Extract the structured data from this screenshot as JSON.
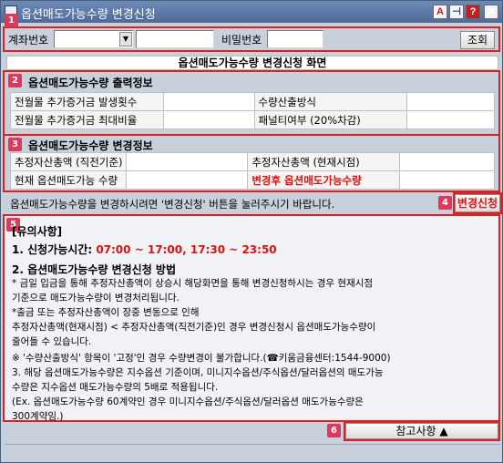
{
  "window": {
    "title": "옵션매도가능수량 변경신청"
  },
  "titlebar_buttons": [
    {
      "name": "font-a-icon",
      "label": "A"
    },
    {
      "name": "pin-icon",
      "label": "⊣"
    },
    {
      "name": "help-icon",
      "label": "?"
    },
    {
      "name": "close-icon",
      "label": "✕"
    }
  ],
  "badges": [
    "1",
    "2",
    "3",
    "4",
    "5",
    "6"
  ],
  "query": {
    "account_label": "계좌번호",
    "account_value": "",
    "account_name_value": "",
    "password_label": "비밀번호",
    "password_value": "",
    "search_button": "조회"
  },
  "screen_header": "옵션매도가능수량 변경신청 화면",
  "output_info": {
    "title": "옵션매도가능수량 출력정보",
    "rows": [
      {
        "label1": "전월물 추가증거금 발생횟수",
        "value1": "",
        "label2": "수량산출방식",
        "value2": ""
      },
      {
        "label1": "전월물 추가증거금 최대비율",
        "value1": "",
        "label2": "패널티여부 (20%차감)",
        "value2": ""
      }
    ]
  },
  "change_info": {
    "title": "옵션매도가능수량 변경정보",
    "rows": [
      {
        "label1": "추정자산총액 (직전기준)",
        "value1": "",
        "label2": "추정자산총액 (현재시점)",
        "value2": ""
      },
      {
        "label1": "현재 옵션매도가능 수량",
        "value1": "",
        "label2": "변경후 옵션매도가능수량",
        "value2": ""
      }
    ]
  },
  "instruction": "옵션매도가능수량을 변경하시려면 '변경신청' 버튼을 눌러주시기 바랍니다.",
  "change_button": "변경신청",
  "notice": {
    "title": "[유의사항]",
    "item1_prefix": "1. 신청가능시간: ",
    "item1_time": "07:00 ~ 17:00, 17:30 ~ 23:50",
    "item2": "2. 옵션매도가능수량 변경신청 방법",
    "l1": " * 금일 입금을 통해 추정자산총액이 상승시 해당화면을 통해 변경신청하시는 경우 현재시점",
    "l2": "   기준으로 매도가능수량이 변경처리됩니다.",
    "l3": " *출금 또는 추정자산총액이 장중 변동으로 인해",
    "l4": "   추정자산총액(현재시점) < 추정자산총액(직전기준)인 경우 변경신청시 옵션매도가능수량이",
    "l5": "   줄어들 수 있습니다.",
    "l6": " ※ '수량산출방식' 항목이 '고정'인 경우 수량변경이 불가합니다.(☎키움금융센터:1544-9000)",
    "l7": " 3. 해당 옵션매도가능수량은 지수옵션 기준이며, 미니지수옵션/주식옵션/달러옵션의 매도가능",
    "l8": "    수량은 지수옵션 매도가능수량의 5배로 적용됩니다.",
    "l9": "    (Ex. 옵션매도가능수량 60계약인 경우 미니지수옵션/주식옵션/달러옵션 매도가능수량은",
    "l10": "    300계약임.)"
  },
  "reference_button": "참고사항 ▲",
  "colors": {
    "accent_red": "#e01010",
    "badge": "#e0385c",
    "title_bar": "#5877a8"
  }
}
